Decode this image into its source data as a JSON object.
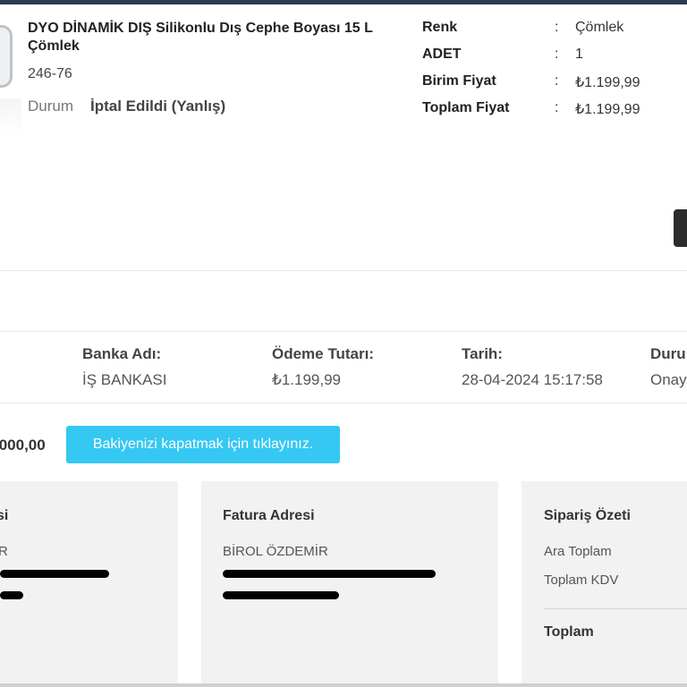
{
  "product": {
    "title": "DYO DİNAMİK DIŞ Silikonlu Dış Cephe Boyası 15 L Çömlek",
    "sku": "246-76",
    "status_label": "Durum",
    "status_value": "İptal Edildi (Yanlış)"
  },
  "specs": [
    {
      "key": "Renk",
      "colon": ":",
      "value": "Çömlek"
    },
    {
      "key": "ADET",
      "colon": ":",
      "value": "1"
    },
    {
      "key": "Birim Fiyat",
      "colon": ":",
      "value": "₺1.199,99"
    },
    {
      "key": "Toplam Fiyat",
      "colon": ":",
      "value": "₺1.199,99"
    }
  ],
  "payment": {
    "bank_label": "Banka Adı:",
    "bank_value": "İŞ BANKASI",
    "amount_label": "Ödeme Tutarı:",
    "amount_value": "₺1.199,99",
    "date_label": "Tarih:",
    "date_value": "28-04-2024 15:17:58",
    "status_label": "Duru",
    "status_value": "Onay"
  },
  "balance": {
    "amount": ".000,00",
    "button_label": "Bakiyenizi kapatmak için tıklayınız."
  },
  "delivery_address": {
    "title": "si",
    "name": "R"
  },
  "invoice_address": {
    "title": "Fatura Adresi",
    "name": "BİROL ÖZDEMİR"
  },
  "order_summary": {
    "title": "Sipariş Özeti",
    "subtotal_label": "Ara Toplam",
    "vat_label": "Toplam KDV",
    "total_label": "Toplam"
  },
  "colors": {
    "accent_button": "#35c8f2",
    "top_bar": "#2b3a52",
    "card_bg": "#f2f2f2"
  }
}
